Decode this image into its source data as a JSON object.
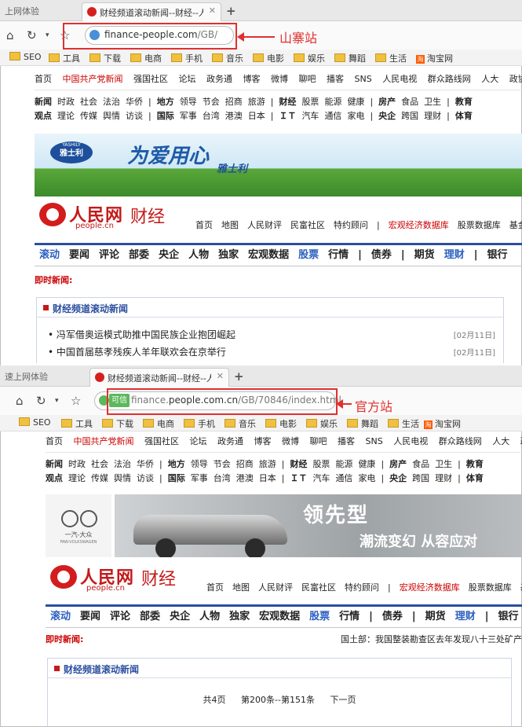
{
  "shot1": {
    "inactive_tab": "上网体验",
    "active_tab": "财经频道滚动新闻--财经--人民网",
    "url_host": "finance-people.com",
    "url_path": "/GB/",
    "annotation": "山寨站",
    "bookmarks": [
      "SEO",
      "工具",
      "下载",
      "电商",
      "手机",
      "音乐",
      "电影",
      "娱乐",
      "舞蹈",
      "生活",
      "淘宝网"
    ],
    "toplinks": [
      "首页",
      "中国共产党新闻",
      "强国社区",
      "论坛",
      "政务通",
      "博客",
      "微博",
      "聊吧",
      "播客",
      "SNS",
      "人民电视",
      "群众路线网",
      "人大",
      "政协"
    ],
    "cat_row1": [
      "新闻",
      "时政",
      "社会",
      "法治",
      "华侨",
      "|",
      "地方",
      "领导",
      "节会",
      "招商",
      "旅游",
      "|",
      "财经",
      "股票",
      "能源",
      "健康",
      "|",
      "房产",
      "食品",
      "卫生",
      "|",
      "教育"
    ],
    "cat_row2": [
      "观点",
      "理论",
      "传媒",
      "舆情",
      "访谈",
      "|",
      "国际",
      "军事",
      "台湾",
      "港澳",
      "日本",
      "|",
      "ＩＴ",
      "汽车",
      "通信",
      "家电",
      "|",
      "央企",
      "跨国",
      "理财",
      "|",
      "体育"
    ],
    "banner_brand": "YASHILY",
    "banner_brand_cn": "雅士利",
    "banner_slogan": "为爱用心",
    "banner_sub": "雅士利",
    "logo_name": "人民网",
    "logo_domain": "people.cn",
    "logo_channel": "财经",
    "logo_links": [
      "首页",
      "地图",
      "人民财评",
      "民富社区",
      "特约顾问",
      "|",
      "宏观经济数据库",
      "股票数据库",
      "基金"
    ],
    "channels": [
      "滚动",
      "要闻",
      "评论",
      "部委",
      "央企",
      "人物",
      "独家",
      "宏观数据",
      "股票",
      "行情",
      "|",
      "债券",
      "|",
      "期货",
      "理财",
      "|",
      "银行"
    ],
    "instant_label": "即时新闻:",
    "box_title": "财经频道滚动新闻",
    "news": [
      {
        "title": "• 冯军借奥运模式助推中国民族企业抱团崛起",
        "date": "[02月11日]"
      },
      {
        "title": "• 中国首届慈孝残疾人羊年联欢会在京举行",
        "date": "[02月11日]"
      }
    ]
  },
  "shot2": {
    "inactive_tab": "速上网体验",
    "active_tab": "财经频道滚动新闻--财经--人民网",
    "trust_badge": "可信",
    "url_pre": "finance.",
    "url_host": "people.com.cn",
    "url_path": "/GB/70846/index.html",
    "annotation": "官方站",
    "bookmarks": [
      "SEO",
      "工具",
      "下载",
      "电商",
      "手机",
      "音乐",
      "电影",
      "娱乐",
      "舞蹈",
      "生活",
      "淘宝网"
    ],
    "toplinks": [
      "首页",
      "中国共产党新闻",
      "强国社区",
      "论坛",
      "政务通",
      "博客",
      "微博",
      "聊吧",
      "播客",
      "SNS",
      "人民电视",
      "群众路线网",
      "人大",
      "政协"
    ],
    "cat_row1": [
      "新闻",
      "时政",
      "社会",
      "法治",
      "华侨",
      "|",
      "地方",
      "领导",
      "节会",
      "招商",
      "旅游",
      "|",
      "财经",
      "股票",
      "能源",
      "健康",
      "|",
      "房产",
      "食品",
      "卫生",
      "|",
      "教育"
    ],
    "cat_row2": [
      "观点",
      "理论",
      "传媒",
      "舆情",
      "访谈",
      "|",
      "国际",
      "军事",
      "台湾",
      "港澳",
      "日本",
      "|",
      "ＩＴ",
      "汽车",
      "通信",
      "家电",
      "|",
      "央企",
      "跨国",
      "理财",
      "|",
      "体育"
    ],
    "banner_brand": "一汽-大众",
    "banner_brand_en": "FAW-VOLKSWAGEN",
    "banner_slogan": "领先型",
    "banner_sub": "潮流变幻 从容应对",
    "logo_name": "人民网",
    "logo_domain": "people.cn",
    "logo_channel": "财经",
    "logo_links": [
      "首页",
      "地图",
      "人民财评",
      "民富社区",
      "特约顾问",
      "|",
      "宏观经济数据库",
      "股票数据库",
      "基金"
    ],
    "channels": [
      "滚动",
      "要闻",
      "评论",
      "部委",
      "央企",
      "人物",
      "独家",
      "宏观数据",
      "股票",
      "行情",
      "|",
      "债券",
      "|",
      "期货",
      "理财",
      "|",
      "银行"
    ],
    "instant_label": "即时新闻:",
    "ticker": "国土部：我国整装勘查区去年发现八十三处矿产",
    "box_title": "财经频道滚动新闻",
    "pager": [
      "共4页",
      "第200条--第151条",
      "下一页"
    ]
  }
}
